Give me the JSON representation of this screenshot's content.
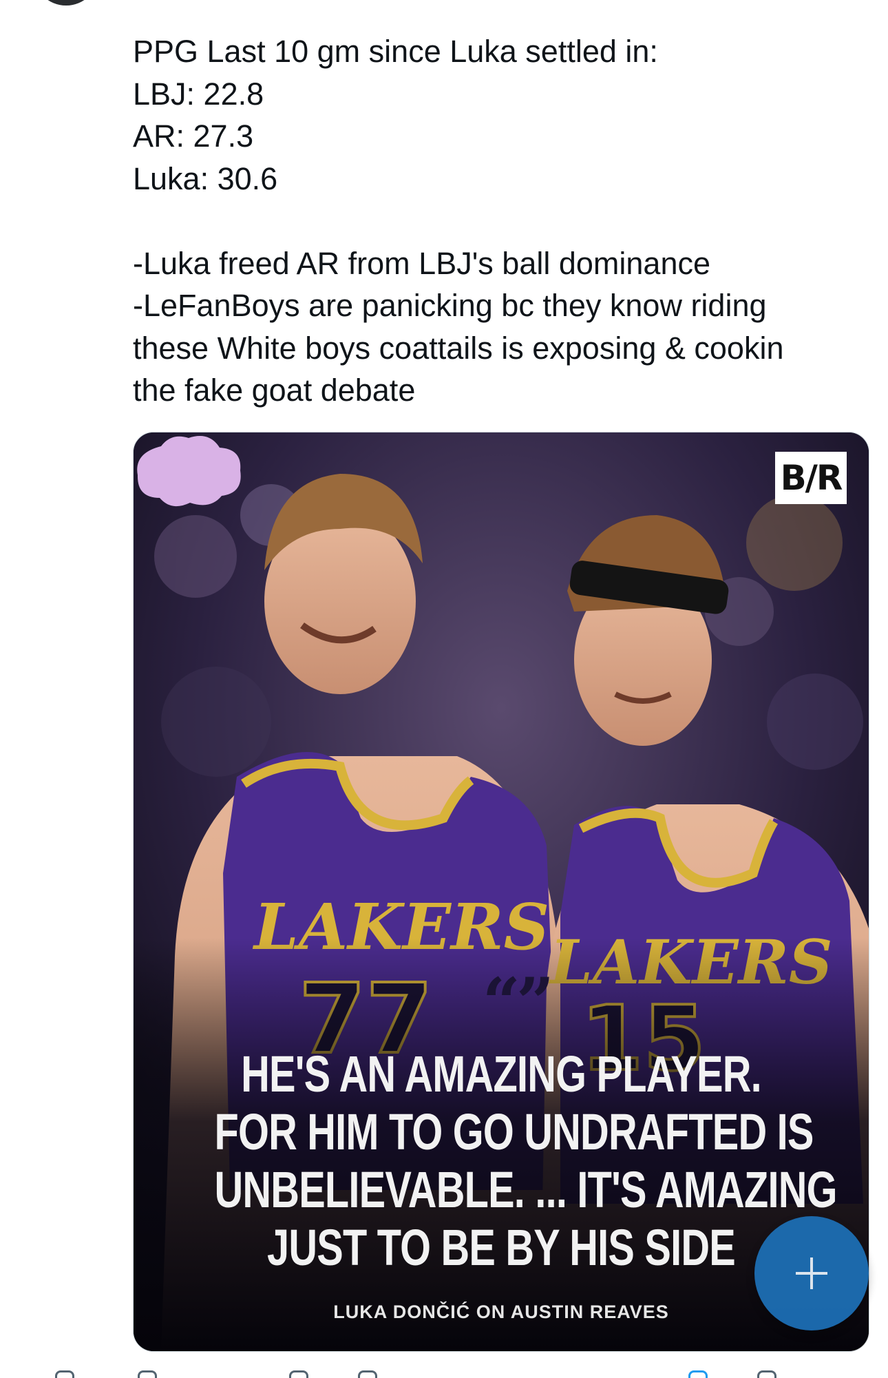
{
  "tweet": {
    "lines": [
      "PPG Last 10 gm since Luka settled in:",
      "LBJ: 22.8",
      "AR: 27.3",
      "Luka: 30.6",
      "-Luka freed AR from LBJ's ball dominance",
      "-LeFanBoys are panicking bc they know riding",
      "these White boys coattails is exposing & cookin",
      "the fake goat debate"
    ]
  },
  "media": {
    "logo": "B/R",
    "quote_marks": "“”",
    "quote_lines": [
      "HE'S AN AMAZING PLAYER.",
      "FOR HIM TO GO UNDRAFTED IS",
      "UNBELIEVABLE. ... IT'S AMAZING",
      "JUST TO BE BY HIS SIDE"
    ],
    "attribution": "LUKA DONČIĆ ON AUSTIN REAVES",
    "jersey_left": {
      "team": "LAKERS",
      "number": "77"
    },
    "jersey_right": {
      "team": "LAKERS",
      "number": "15"
    },
    "colors": {
      "jersey": "#4b2c8f",
      "trim": "#d8b33a",
      "bubble": "#d9b2e6"
    }
  },
  "compose_button": {
    "icon": "plus-icon",
    "color": "#1d6fb5"
  },
  "action_bar": {
    "icons": [
      "reply-icon",
      "retweet-icon",
      "like-icon",
      "views-icon",
      "bookmark-icon",
      "share-icon"
    ]
  }
}
